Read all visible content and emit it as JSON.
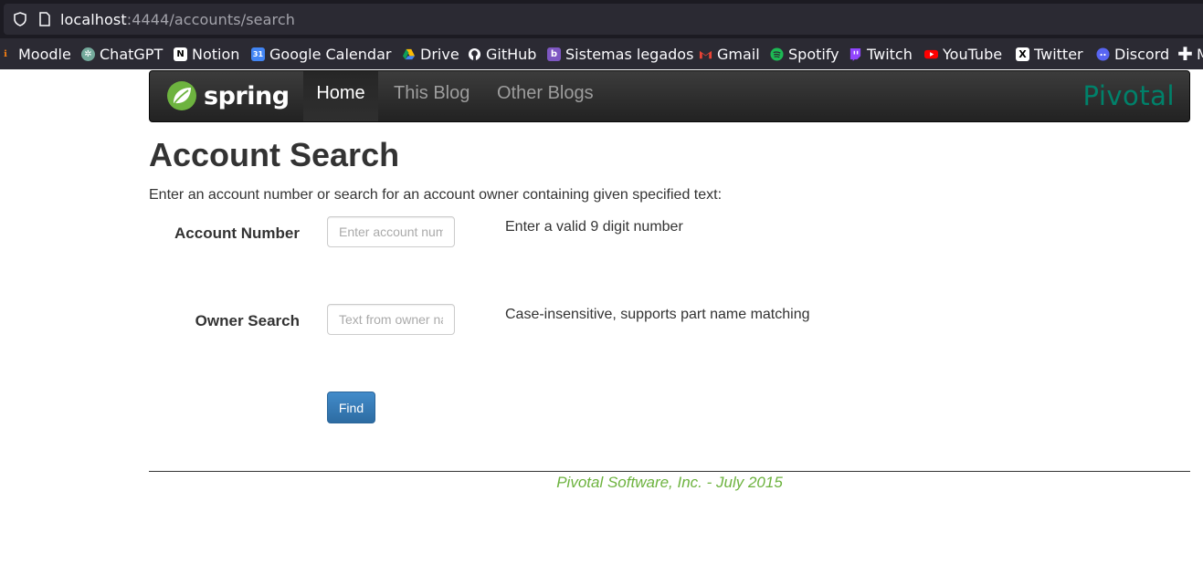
{
  "browser": {
    "url_host": "localhost",
    "url_rest": ":4444/accounts/search",
    "bookmarks": [
      {
        "label": "Moodle",
        "icon": "moodle-icon",
        "color": "#f98012"
      },
      {
        "label": "ChatGPT",
        "icon": "chatgpt-icon",
        "color": "#74aa9c"
      },
      {
        "label": "Notion",
        "icon": "notion-icon",
        "color": "#ffffff"
      },
      {
        "label": "Google Calendar",
        "icon": "google-calendar-icon",
        "color": "#4285f4"
      },
      {
        "label": "Drive",
        "icon": "drive-icon",
        "color": "#fbbc04"
      },
      {
        "label": "GitHub",
        "icon": "github-icon",
        "color": "#ffffff"
      },
      {
        "label": "Sistemas legados",
        "icon": "sistemas-legados-icon",
        "color": "#7e57c2"
      },
      {
        "label": "Gmail",
        "icon": "gmail-icon",
        "color": "#ea4335"
      },
      {
        "label": "Spotify",
        "icon": "spotify-icon",
        "color": "#1db954"
      },
      {
        "label": "Twitch",
        "icon": "twitch-icon",
        "color": "#9146ff"
      },
      {
        "label": "YouTube",
        "icon": "youtube-icon",
        "color": "#ff0000"
      },
      {
        "label": "Twitter",
        "icon": "twitter-x-icon",
        "color": "#ffffff"
      },
      {
        "label": "Discord",
        "icon": "discord-icon",
        "color": "#5865f2"
      },
      {
        "label": "M",
        "icon": "plus-icon",
        "color": "#ffffff"
      }
    ]
  },
  "navbar": {
    "brand": "spring",
    "items": [
      {
        "label": "Home",
        "active": true
      },
      {
        "label": "This Blog",
        "active": false
      },
      {
        "label": "Other Blogs",
        "active": false
      }
    ],
    "partner": "Pivotal"
  },
  "page": {
    "title": "Account Search",
    "intro": "Enter an account number or search for an account owner containing given specified text:",
    "account_label": "Account Number",
    "account_placeholder": "Enter account number",
    "account_help": "Enter a valid 9 digit number",
    "owner_label": "Owner Search",
    "owner_placeholder": "Text from owner name",
    "owner_help": "Case-insensitive, supports part name matching",
    "find_label": "Find"
  },
  "footer": {
    "text": "Pivotal Software, Inc. - July 2015"
  },
  "colors": {
    "spring_green": "#6db33f",
    "pivotal_teal": "#00816a",
    "button_blue": "#428bca"
  }
}
